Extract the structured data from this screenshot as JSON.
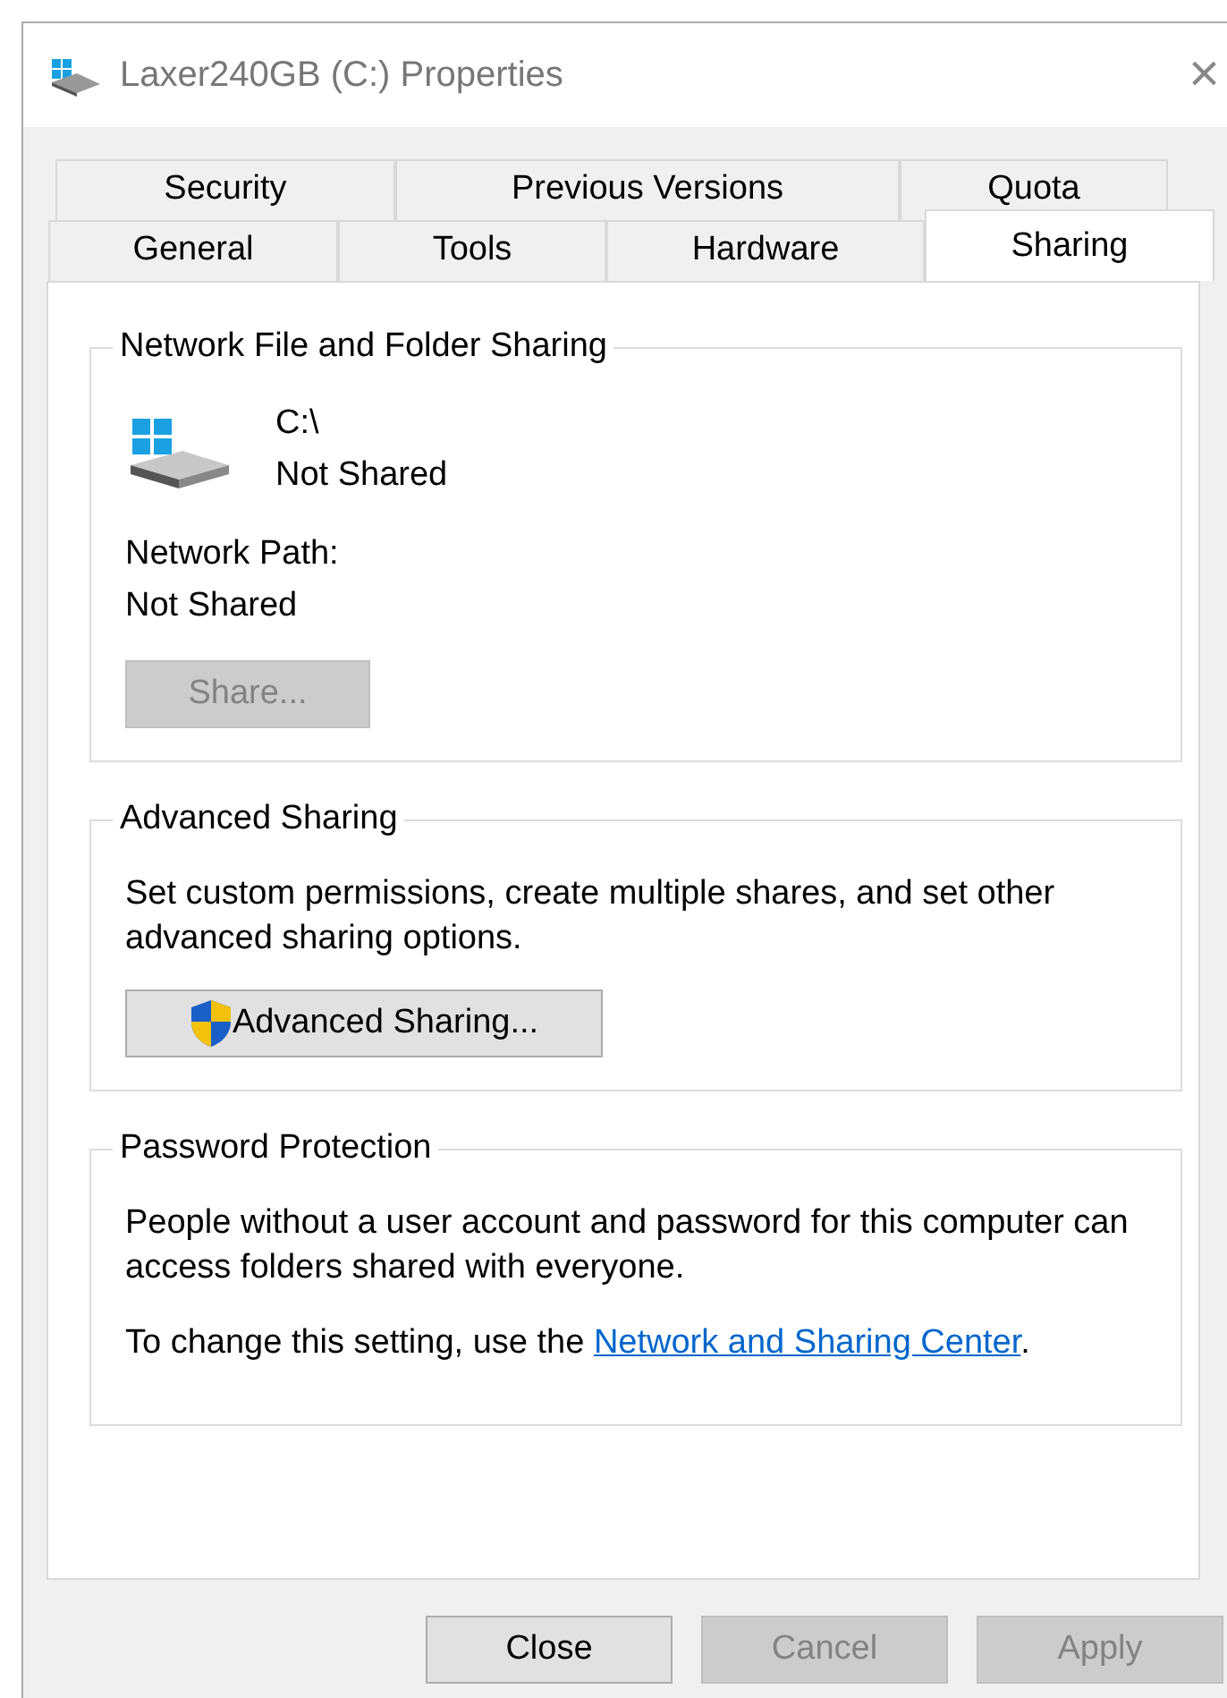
{
  "window": {
    "title": "Laxer240GB (C:) Properties",
    "close": "×"
  },
  "tab_rows": [
    [
      {
        "label": "Security",
        "selected": false
      },
      {
        "label": "Previous Versions",
        "selected": false
      },
      {
        "label": "Quota",
        "selected": false
      }
    ],
    [
      {
        "label": "General",
        "selected": false
      },
      {
        "label": "Tools",
        "selected": false
      },
      {
        "label": "Hardware",
        "selected": false
      },
      {
        "label": "Sharing",
        "selected": true
      }
    ]
  ],
  "network_sharing": {
    "title": "Network File and Folder Sharing",
    "drive_path": "C:\\",
    "drive_status": "Not Shared",
    "network_path_label": "Network Path:",
    "network_path": "Not Shared",
    "share_button": {
      "label": "Share...",
      "disabled": true
    }
  },
  "advanced_sharing": {
    "title": "Advanced Sharing",
    "description": "Set custom permissions, create multiple shares, and set other advanced sharing options.",
    "button": {
      "label": "Advanced Sharing...",
      "disabled": false
    }
  },
  "password_protection": {
    "title": "Password Protection",
    "description": "People without a user account and password for this computer can access folders shared with everyone.",
    "note_prefix": "To change this setting, use the",
    "link": "Network and Sharing Center",
    "note_suffix": "."
  },
  "buttons": [
    {
      "label": "Close",
      "disabled": false
    },
    {
      "label": "Cancel",
      "disabled": true
    },
    {
      "label": "Apply",
      "disabled": true
    }
  ]
}
